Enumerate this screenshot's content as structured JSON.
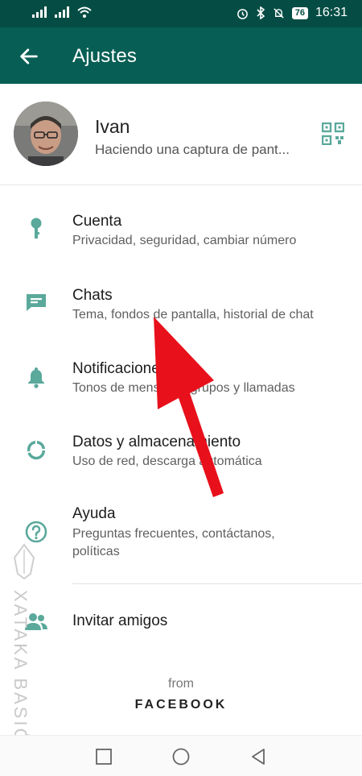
{
  "status_bar": {
    "battery": "76",
    "time": "16:31"
  },
  "app_bar": {
    "title": "Ajustes"
  },
  "profile": {
    "name": "Ivan",
    "status": "Haciendo una captura de pant..."
  },
  "settings": [
    {
      "title": "Cuenta",
      "subtitle": "Privacidad, seguridad, cambiar número",
      "icon": "key-icon"
    },
    {
      "title": "Chats",
      "subtitle": "Tema, fondos de pantalla, historial de chat",
      "icon": "chat-icon"
    },
    {
      "title": "Notificaciones",
      "subtitle": "Tonos de mensajes, grupos y llamadas",
      "icon": "bell-icon"
    },
    {
      "title": "Datos y almacenamiento",
      "subtitle": "Uso de red, descarga automática",
      "icon": "data-usage-icon"
    },
    {
      "title": "Ayuda",
      "subtitle": "Preguntas frecuentes, contáctanos, políticas",
      "icon": "help-icon"
    },
    {
      "title": "Invitar amigos",
      "icon": "people-icon"
    }
  ],
  "footer": {
    "from": "from",
    "brand": "FACEBOOK"
  },
  "watermark": {
    "text": "XATAKA BASICS"
  },
  "colors": {
    "header": "#075e54",
    "status_bar": "#054d44",
    "icon": "#5aa99b",
    "arrow": "#e8101b"
  }
}
